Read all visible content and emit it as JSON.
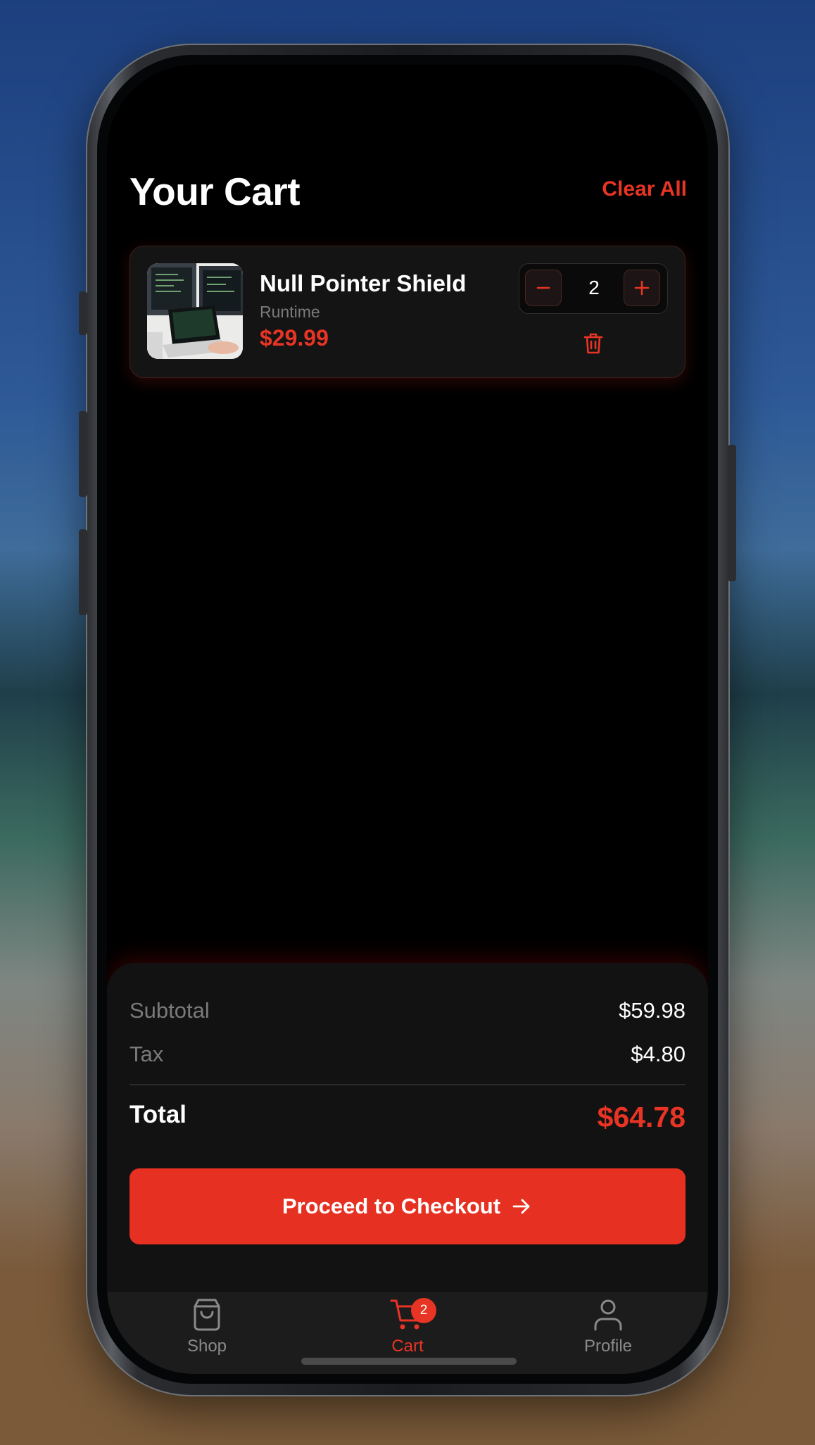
{
  "header": {
    "title": "Your Cart",
    "clear_label": "Clear All"
  },
  "cart_items": [
    {
      "name": "Null Pointer Shield",
      "category": "Runtime",
      "price": "$29.99",
      "quantity": "2"
    }
  ],
  "summary": {
    "subtotal_label": "Subtotal",
    "subtotal_value": "$59.98",
    "tax_label": "Tax",
    "tax_value": "$4.80",
    "total_label": "Total",
    "total_value": "$64.78",
    "checkout_label": "Proceed to Checkout"
  },
  "tabbar": {
    "tabs": [
      {
        "label": "Shop",
        "icon": "shopping-bag-icon",
        "active": false
      },
      {
        "label": "Cart",
        "icon": "cart-icon",
        "active": true,
        "badge": "2"
      },
      {
        "label": "Profile",
        "icon": "user-icon",
        "active": false
      }
    ]
  },
  "colors": {
    "accent": "#e83424",
    "background": "#000000",
    "surface": "#141414",
    "muted": "#7a7a7a"
  }
}
